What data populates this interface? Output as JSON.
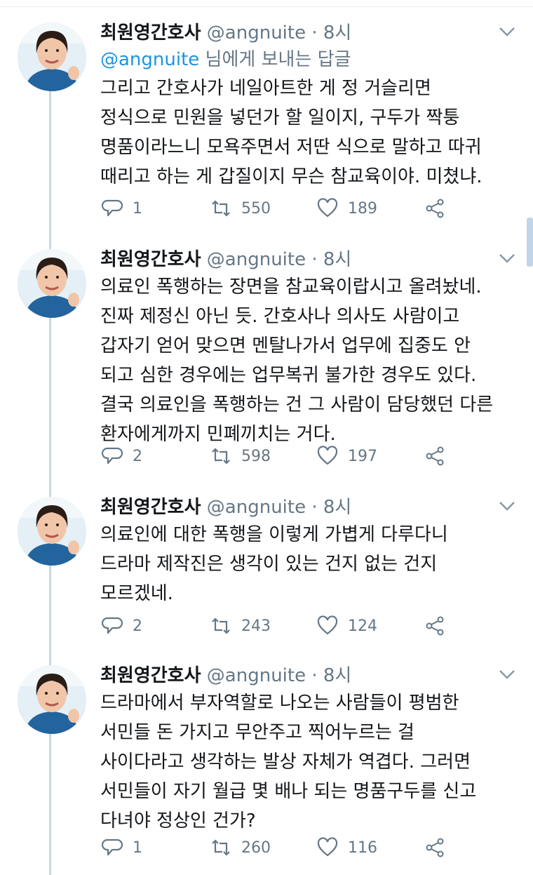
{
  "colors": {
    "accent": "#1b95e0",
    "muted": "#657786",
    "text": "#14171a",
    "thread_line": "#ccd6dd"
  },
  "icons": [
    "reply-icon",
    "retweet-icon",
    "like-icon",
    "share-icon",
    "chevron-down-icon"
  ],
  "tweets": [
    {
      "name": "최원영간호사",
      "handle": "@angnuite",
      "time": "· 8시",
      "reply_mention": "@angnuite",
      "reply_suffix": " 님에게 보내는 답글",
      "lines": [
        "그리고 간호사가 네일아트한 게 정 거슬리면",
        "정식으로 민원을 넣던가 할 일이지, 구두가 짝퉁",
        "명품이라느니 모욕주면서 저딴 식으로 말하고 따귀",
        "때리고 하는 게 갑질이지 무슨 참교육이야. 미쳤냐."
      ],
      "replies": "1",
      "retweets": "550",
      "likes": "189"
    },
    {
      "name": "최원영간호사",
      "handle": "@angnuite",
      "time": "· 8시",
      "lines": [
        "의료인 폭행하는 장면을 참교육이랍시고 올려놨네.",
        "진짜 제정신 아닌 듯. 간호사나 의사도 사람이고",
        "갑자기 얻어 맞으면 멘탈나가서 업무에 집중도 안",
        "되고 심한 경우에는 업무복귀 불가한 경우도 있다.",
        "결국 의료인을 폭행하는 건 그 사람이 담당했던 다른",
        "환자에게까지 민폐끼치는 거다."
      ],
      "replies": "2",
      "retweets": "598",
      "likes": "197"
    },
    {
      "name": "최원영간호사",
      "handle": "@angnuite",
      "time": "· 8시",
      "lines": [
        "의료인에 대한 폭행을 이렇게 가볍게 다루다니",
        "드라마 제작진은 생각이 있는 건지 없는 건지",
        "모르겠네."
      ],
      "replies": "2",
      "retweets": "243",
      "likes": "124"
    },
    {
      "name": "최원영간호사",
      "handle": "@angnuite",
      "time": "· 8시",
      "lines": [
        "드라마에서 부자역할로 나오는 사람들이 평범한",
        "서민들 돈 가지고 무안주고 찍어누르는 걸",
        "사이다라고 생각하는 발상 자체가 역겹다. 그러면",
        "서민들이 자기 월급 몇 배나 되는 명품구두를 신고",
        "다녀야 정상인 건가?"
      ],
      "replies": "1",
      "retweets": "260",
      "likes": "116"
    }
  ]
}
